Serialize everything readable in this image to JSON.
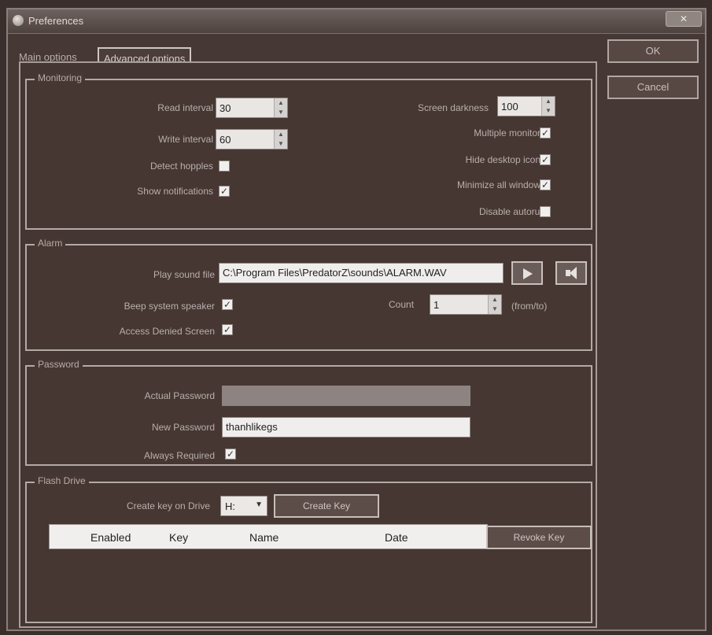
{
  "window": {
    "title": "Preferences",
    "close_label": ""
  },
  "buttons": {
    "ok": "OK",
    "cancel": "Cancel"
  },
  "tabs": [
    {
      "label": "Main options",
      "active": false
    },
    {
      "label": "Advanced options",
      "active": true
    }
  ],
  "monitoring": {
    "legend": "Monitoring",
    "read_interval_label": "Read interval",
    "read_interval_value": "30",
    "write_interval_label": "Write interval",
    "write_interval_value": "60",
    "detect_hopples_label": "Detect hopples",
    "detect_hopples_checked": false,
    "show_notifications_label": "Show notifications",
    "show_notifications_checked": true,
    "screen_darkness_label": "Screen darkness",
    "screen_darkness_value": "100",
    "multiple_monitors_label": "Multiple monitors",
    "multiple_monitors_checked": true,
    "hide_desktop_icons_label": "Hide desktop icons",
    "hide_desktop_icons_checked": true,
    "minimize_all_windows_label": "Minimize all windows",
    "minimize_all_windows_checked": true,
    "disable_autorun_label": "Disable autorun",
    "disable_autorun_checked": false
  },
  "alarm": {
    "legend": "Alarm",
    "play_sound_label": "Play sound file",
    "play_sound_value": "C:\\Program Files\\PredatorZ\\sounds\\ALARM.WAV",
    "beep_label": "Beep system speaker",
    "beep_checked": true,
    "count_label": "Count",
    "count_value": "1",
    "count_unit": "(from/to)",
    "access_denied_label": "Access Denied Screen",
    "access_denied_checked": true,
    "play_icon": "play-icon",
    "speaker_icon": "speaker-icon"
  },
  "password": {
    "legend": "Password",
    "actual_label": "Actual Password",
    "actual_value": "",
    "new_label": "New Password",
    "new_value": "thanhlikegs",
    "always_required_label": "Always Required",
    "always_required_checked": true
  },
  "flash_drive": {
    "legend": "Flash Drive",
    "create_key_on_drive_label": "Create key on Drive",
    "drive_value": "H:",
    "create_key_button": "Create Key",
    "revoke_key_button": "Revoke Key",
    "columns": [
      "Enabled",
      "Key",
      "Name",
      "Date"
    ]
  }
}
